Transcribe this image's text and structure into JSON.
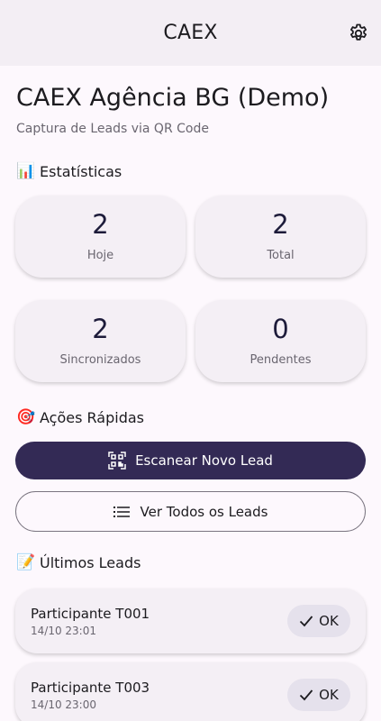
{
  "appbar": {
    "title": "CAEX",
    "settings_icon": "gear-icon"
  },
  "header": {
    "title": "CAEX Agência BG (Demo)",
    "subtitle": "Captura de Leads via QR Code"
  },
  "stats": {
    "emoji": "📊",
    "title": "Estatísticas",
    "cards": [
      {
        "value": "2",
        "label": "Hoje"
      },
      {
        "value": "2",
        "label": "Total"
      },
      {
        "value": "2",
        "label": "Sincronizados"
      },
      {
        "value": "0",
        "label": "Pendentes"
      }
    ]
  },
  "actions": {
    "emoji": "🎯",
    "title": "Ações Rápidas",
    "scan_label": "Escanear Novo Lead",
    "scan_icon": "qr-code-scan-icon",
    "view_label": "Ver Todos os Leads",
    "view_icon": "list-icon"
  },
  "recent": {
    "emoji": "📝",
    "title": "Últimos Leads",
    "leads": [
      {
        "name": "Participante T001",
        "date": "14/10 23:01",
        "status": "OK"
      },
      {
        "name": "Participante T003",
        "date": "14/10 23:00",
        "status": "OK"
      }
    ]
  },
  "colors": {
    "primary": "#332a55",
    "background": "#fdf8fd",
    "appbar": "#f3eef4",
    "card": "#f4eff5",
    "chip": "#e5e1ec"
  }
}
